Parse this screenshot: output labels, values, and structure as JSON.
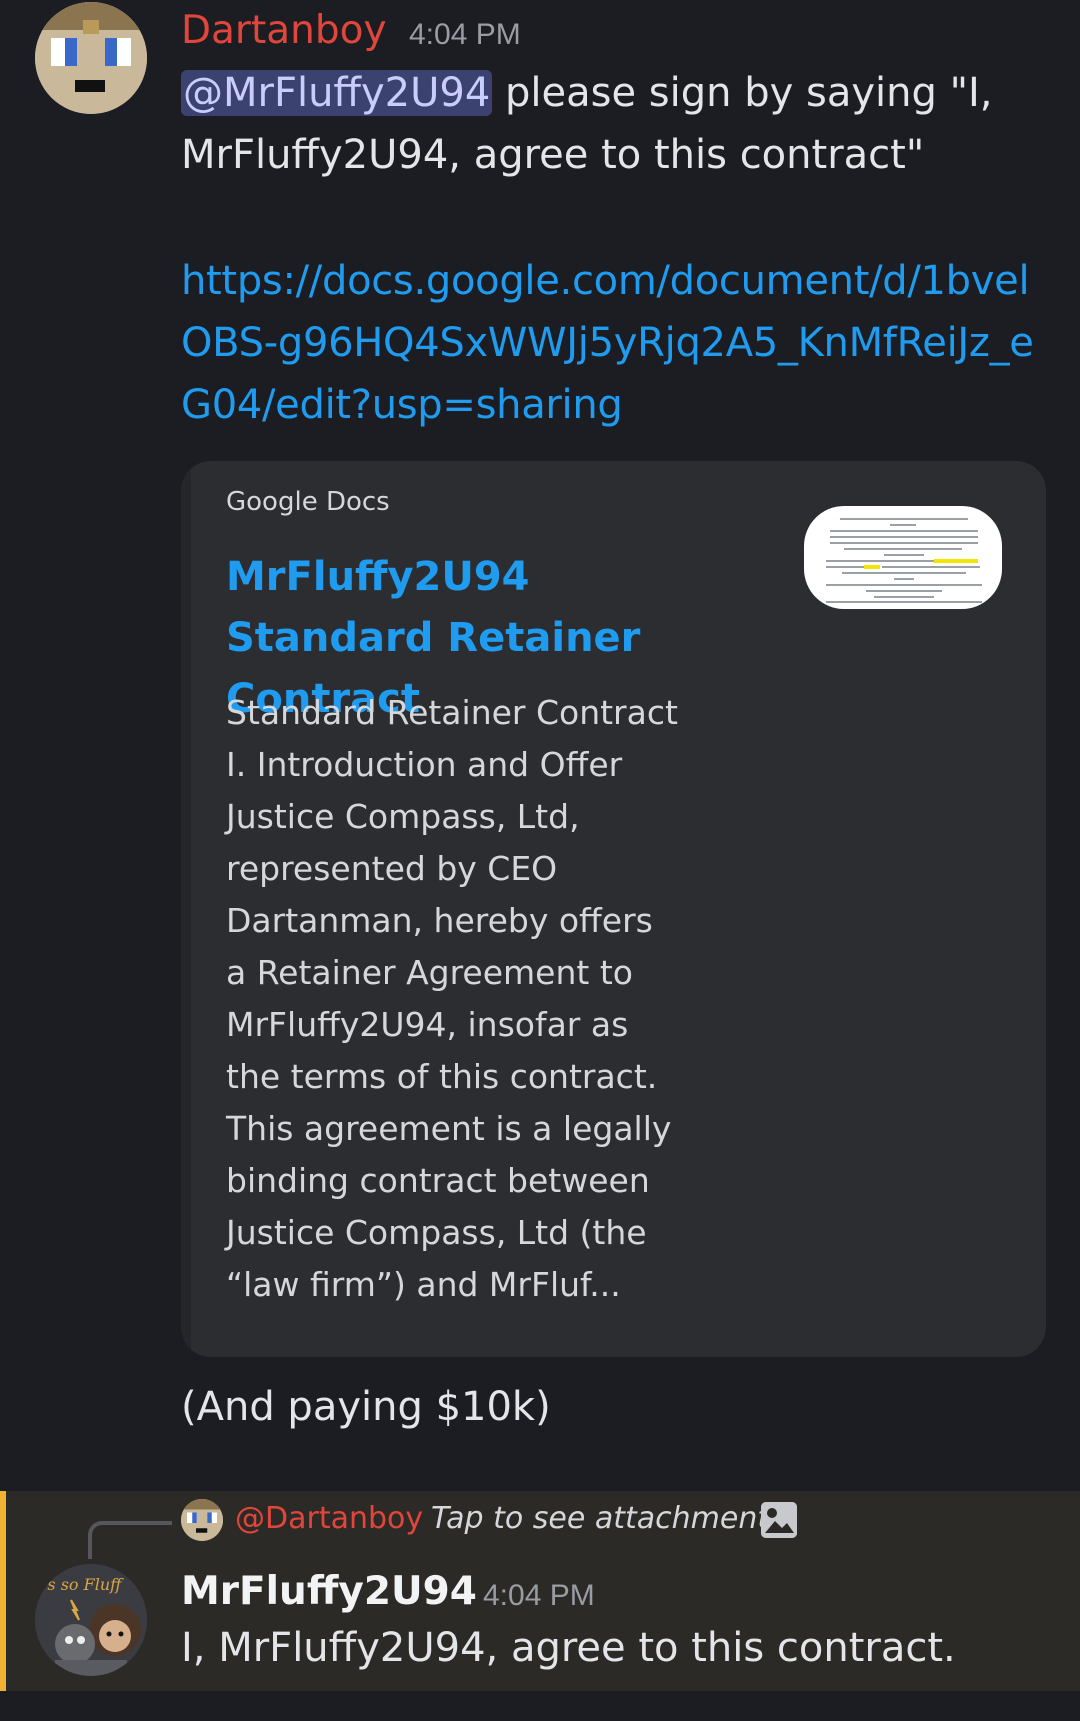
{
  "message1": {
    "author": "Dartanboy",
    "timestamp": "4:04 PM",
    "mention": "@MrFluffy2U94",
    "text": " please sign by saying \"I, MrFluffy2U94, agree to this contract\"",
    "link": "https://docs.google.com/document/d/1bvelOBS-g96HQ4SxWWJj5yRjq2A5_KnMfReiJz_eG04/edit?usp=sharing",
    "embed": {
      "provider": "Google Docs",
      "title": "MrFluffy2U94 Standard Retainer Contract",
      "description_lines": [
        "Standard Retainer Contract",
        "I. Introduction and Offer",
        "Justice Compass, Ltd,",
        "represented by CEO",
        "Dartanman, hereby offers",
        "a Retainer Agreement to",
        "MrFluffy2U94, insofar as",
        "the terms of this contract.",
        "This agreement is a legally",
        "binding contract between",
        "Justice Compass, Ltd (the",
        "“law firm”) and MrFluf..."
      ]
    },
    "followup": "(And paying $10k)"
  },
  "message2": {
    "reply": {
      "author": "@Dartanboy",
      "text": "Tap to see attachment",
      "icon": "image-icon"
    },
    "avatar_text": "'s so Fluff",
    "author": "MrFluffy2U94",
    "timestamp": "4:04 PM",
    "text": "I, MrFluffy2U94, agree to this contract."
  },
  "colors": {
    "background": "#1c1d22",
    "author_red": "#e0463b",
    "link_blue": "#1f9cf0",
    "mention_bg": "#3c4270",
    "highlight_bar": "#f0b232"
  }
}
